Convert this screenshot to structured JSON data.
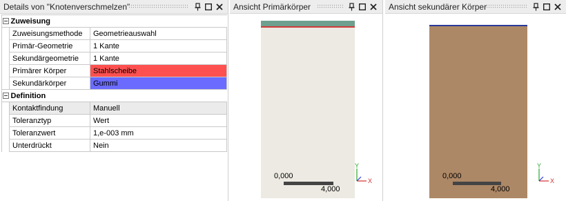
{
  "details_panel": {
    "title": "Details von \"Knotenverschmelzen\"",
    "groups": [
      {
        "name": "Zuweisung",
        "rows": [
          {
            "key": "Zuweisungsmethode",
            "value": "Geometrieauswahl",
            "style": "plain"
          },
          {
            "key": "Primär-Geometrie",
            "value": "1 Kante",
            "style": "plain"
          },
          {
            "key": "Sekundärgeometrie",
            "value": "1 Kante",
            "style": "plain"
          },
          {
            "key": "Primärer Körper",
            "value": "Stahlscheibe",
            "style": "primary",
            "color": "#ff5050"
          },
          {
            "key": "Sekundärkörper",
            "value": "Gummi",
            "style": "secondary",
            "color": "#6b6bff"
          }
        ]
      },
      {
        "name": "Definition",
        "rows": [
          {
            "key": "Kontaktfindung",
            "value": "Manuell",
            "style": "readonly"
          },
          {
            "key": "Toleranztyp",
            "value": "Wert",
            "style": "plain"
          },
          {
            "key": "Toleranzwert",
            "value": "1,e-003 mm",
            "style": "plain"
          },
          {
            "key": "Unterdrückt",
            "value": "Nein",
            "style": "plain"
          }
        ]
      }
    ]
  },
  "primary_view": {
    "title": "Ansicht Primärkörper",
    "scale_start": "0,000",
    "scale_end": "4,000",
    "axis_y": "Y",
    "axis_x": "X"
  },
  "secondary_view": {
    "title": "Ansicht sekundärer Körper",
    "scale_start": "0,000",
    "scale_end": "4,000",
    "axis_y": "Y",
    "axis_x": "X"
  },
  "title_controls": [
    "pin-icon",
    "restore-window-icon",
    "close-icon"
  ],
  "colors": {
    "primary_body": "#eceae2",
    "primary_edge": "#d23a3a",
    "secondary_body": "#ad8866",
    "secondary_edge": "#2a3a9a",
    "axis_y": "#2aa82a",
    "axis_x": "#d43030",
    "axis_z": "#2a3ad0"
  }
}
